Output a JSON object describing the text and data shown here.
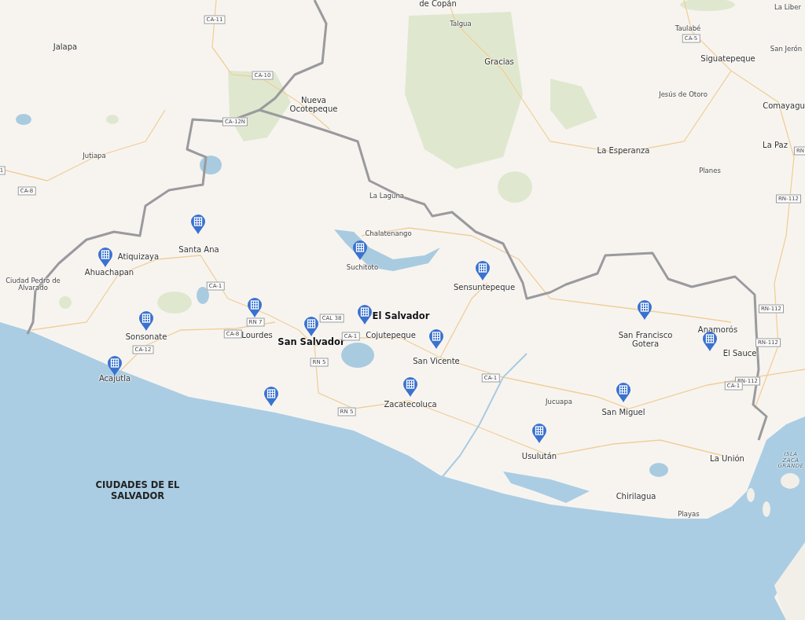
{
  "map": {
    "title": "CIUDADES DE EL SALVADOR",
    "places": [
      {
        "name": "de Copán",
        "kind": "town"
      },
      {
        "name": "Talgua",
        "kind": "village"
      },
      {
        "name": "Gracias",
        "kind": "town"
      },
      {
        "name": "La Liber",
        "kind": "village"
      },
      {
        "name": "Taulabé",
        "kind": "village"
      },
      {
        "name": "San Jerón",
        "kind": "village"
      },
      {
        "name": "Siguatepeque",
        "kind": "town"
      },
      {
        "name": "Jesús de Otoro",
        "kind": "village"
      },
      {
        "name": "Comayagu",
        "kind": "town"
      },
      {
        "name": "Jalapa",
        "kind": "town"
      },
      {
        "name": "Nueva Ocotepeque",
        "kind": "town"
      },
      {
        "name": "La Paz",
        "kind": "town"
      },
      {
        "name": "La Esperanza",
        "kind": "town"
      },
      {
        "name": "Jutiapa",
        "kind": "village"
      },
      {
        "name": "Planes",
        "kind": "village"
      },
      {
        "name": "La Laguna",
        "kind": "village"
      },
      {
        "name": "Chalatenango",
        "kind": "village"
      },
      {
        "name": "Santa Ana",
        "kind": "town"
      },
      {
        "name": "Atiquizaya",
        "kind": "town"
      },
      {
        "name": "Suchitoto",
        "kind": "village"
      },
      {
        "name": "Ahuachapan",
        "kind": "town"
      },
      {
        "name": "Ciudad Pedro de Alvarado",
        "kind": "village"
      },
      {
        "name": "Sensuntepeque",
        "kind": "town"
      },
      {
        "name": "El Salvador",
        "kind": "country"
      },
      {
        "name": "Sonsonate",
        "kind": "town"
      },
      {
        "name": "Lourdes",
        "kind": "town"
      },
      {
        "name": "Cojutepeque",
        "kind": "town"
      },
      {
        "name": "San Francisco Gotera",
        "kind": "town"
      },
      {
        "name": "Anamorós",
        "kind": "town"
      },
      {
        "name": "San Salvador",
        "kind": "capital"
      },
      {
        "name": "El Sauce",
        "kind": "town"
      },
      {
        "name": "San Vicente",
        "kind": "town"
      },
      {
        "name": "Acajutla",
        "kind": "town"
      },
      {
        "name": "Jucuapa",
        "kind": "village"
      },
      {
        "name": "Zacatecoluca",
        "kind": "town"
      },
      {
        "name": "San Miguel",
        "kind": "town"
      },
      {
        "name": "Usulután",
        "kind": "town"
      },
      {
        "name": "La Unión",
        "kind": "town"
      },
      {
        "name": "ISLA ZACA GRANDE",
        "kind": "island"
      },
      {
        "name": "Chirilagua",
        "kind": "town"
      },
      {
        "name": "Playas",
        "kind": "village"
      }
    ],
    "road_shields": [
      {
        "label": "CA-11"
      },
      {
        "label": "CA-5"
      },
      {
        "label": "CA-10"
      },
      {
        "label": "CA-12N"
      },
      {
        "label": "RN"
      },
      {
        "label": "1"
      },
      {
        "label": "CA-8"
      },
      {
        "label": "RN-112"
      },
      {
        "label": "CA-1"
      },
      {
        "label": "RN-112"
      },
      {
        "label": "CAL 38"
      },
      {
        "label": "RN 7"
      },
      {
        "label": "CA-8"
      },
      {
        "label": "CA-1"
      },
      {
        "label": "RN-112"
      },
      {
        "label": "CA-12"
      },
      {
        "label": "RN 5"
      },
      {
        "label": "CA-1"
      },
      {
        "label": "RN-112"
      },
      {
        "label": "CA-1"
      },
      {
        "label": "RN 5"
      }
    ]
  }
}
